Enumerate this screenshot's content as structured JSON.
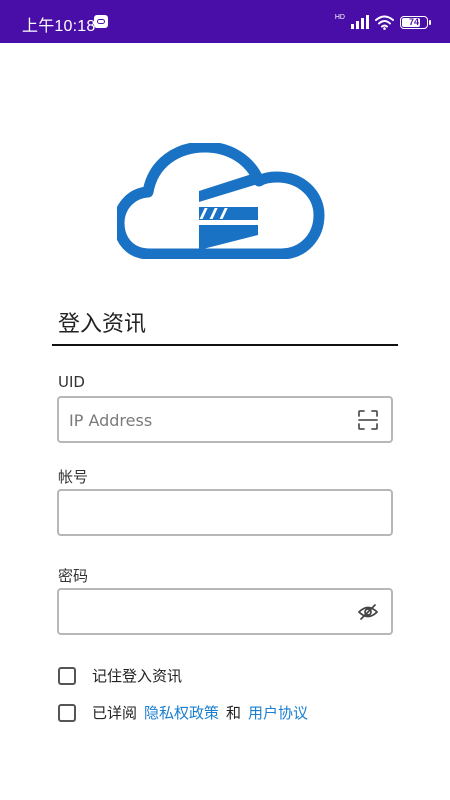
{
  "status_bar": {
    "time": "上午10:18",
    "network": "HD",
    "battery": 74,
    "icons": [
      "notification-icon",
      "signal-icon",
      "wifi-icon",
      "battery-icon"
    ]
  },
  "logo": {
    "icon": "cloud-logo-icon",
    "color": "#1a72c4"
  },
  "login": {
    "section_title": "登入资讯",
    "uid_label": "UID",
    "uid_placeholder": "IP Address",
    "uid_value": "",
    "scan_icon": "scan-icon",
    "account_label": "帐号",
    "account_value": "",
    "password_label": "密码",
    "password_value": "",
    "visibility_icon": "eye-off-icon",
    "remember_label": "记住登入资讯",
    "remember_checked": false,
    "agreement_prefix": "已详阅",
    "privacy_link": "隐私权政策",
    "agreement_and": "和",
    "terms_link": "用户协议",
    "agreement_checked": false
  },
  "colors": {
    "status_bar": "#4a0ea8",
    "link": "#1a7fd0",
    "logo": "#1a72c4"
  }
}
